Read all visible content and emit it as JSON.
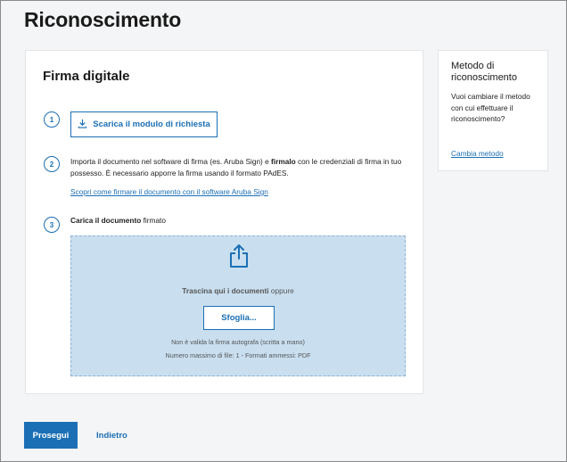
{
  "page": {
    "title": "Riconoscimento"
  },
  "card": {
    "title": "Firma digitale",
    "step1": {
      "number": "1",
      "download_label": "Scarica il modulo di richiesta",
      "icon": "download-icon"
    },
    "step2": {
      "number": "2",
      "text_a": "Importa il documento nel software di firma (es. Aruba Sign) e ",
      "text_bold": "firmalo",
      "text_b": " con le credenziali di firma in tuo possesso. È necessario apporre la firma usando il formato PAdES.",
      "link": "Scopri come firmare il documento con il software Aruba Sign"
    },
    "step3": {
      "number": "3",
      "label_bold": "Carica il documento",
      "label_rest": " firmato",
      "upload_icon": "share-upload-icon",
      "drop_bold": "Trascina qui i documenti",
      "drop_rest": " oppure",
      "browse_label": "Sfoglia...",
      "note1": "Non è valida la firma autografa (scritta a mano)",
      "note2": "Numero massimo di file: 1 - Formati ammessi: PDF"
    }
  },
  "side": {
    "title": "Metodo di riconoscimento",
    "text": "Vuoi cambiare il metodo con cui effettuare il riconoscimento?",
    "link": "Cambia metodo"
  },
  "footer": {
    "primary_label": "Prosegui",
    "secondary_label": "Indietro"
  },
  "colors": {
    "accent": "#1b6fb5",
    "dropzone": "#c9dff0",
    "background": "#f4f5f6"
  }
}
